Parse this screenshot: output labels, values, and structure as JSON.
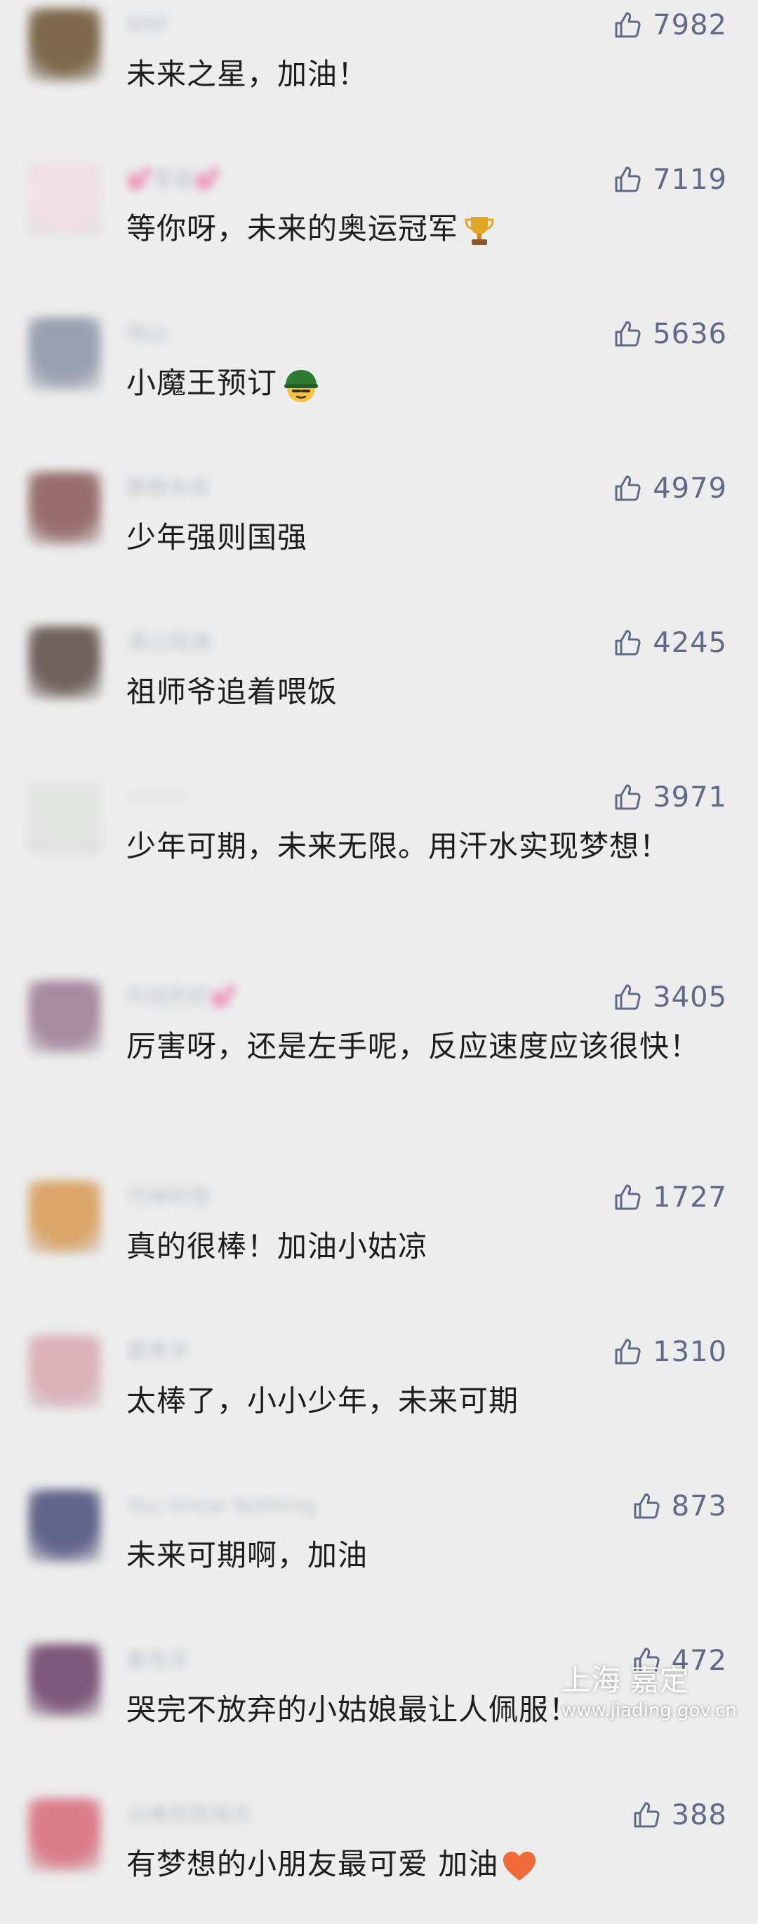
{
  "colors": {
    "background": "#ededed",
    "comment_text": "#1d1d1d",
    "like_count": "#5f6a86",
    "username_blurred": "#9aa2b5"
  },
  "comments": [
    {
      "username": "NNF",
      "text": "未来之星，加油！",
      "likes": "7982",
      "avatar_color": "#6b5230",
      "emoji": ""
    },
    {
      "username": "💕荟荟💕",
      "text": "等你呀，未来的奥运冠军",
      "likes": "7119",
      "avatar_color": "#f3dfe6",
      "emoji": "trophy-icon"
    },
    {
      "username": "晓山",
      "text": "小魔王预订",
      "likes": "5636",
      "avatar_color": "#8b94a6",
      "emoji": "helmet-face-icon"
    },
    {
      "username": "静静未来",
      "text": "少年强则国强",
      "likes": "4979",
      "avatar_color": "#8a5a58",
      "emoji": ""
    },
    {
      "username": "清山观澜",
      "text": "祖师爷追着喂饭",
      "likes": "4245",
      "avatar_color": "#5b4a44",
      "emoji": ""
    },
    {
      "username": "一一一",
      "text": "少年可期，未来无限。用汗水实现梦想！",
      "likes": "3971",
      "avatar_color": "#e2e4e2",
      "emoji": ""
    },
    {
      "username": "科技奶奶💕",
      "text": "厉害呀，还是左手呢，反应速度应该很快！",
      "likes": "3405",
      "avatar_color": "#9b7a92",
      "emoji": ""
    },
    {
      "username": "竹林听雨",
      "text": "真的很棒！加油小姑凉",
      "likes": "1727",
      "avatar_color": "#d79a52",
      "emoji": ""
    },
    {
      "username": "夏季半",
      "text": "太棒了，小小少年，未来可期",
      "likes": "1310",
      "avatar_color": "#d8a8b0",
      "emoji": ""
    },
    {
      "username": "You Know Nothing",
      "text": "未来可期啊，加油",
      "likes": "873",
      "avatar_color": "#4a4e7a",
      "emoji": ""
    },
    {
      "username": "紫色天",
      "text": "哭完不放弃的小姑娘最让人佩服！",
      "likes": "472",
      "avatar_color": "#6a3f66",
      "emoji": ""
    },
    {
      "username": "云峰观观海天",
      "text": "有梦想的小朋友最可爱 加油",
      "likes": "388",
      "avatar_color": "#d86a7a",
      "emoji": "heart-icon"
    }
  ],
  "watermark": {
    "title": "上海 嘉定",
    "url": "www.jiading.gov.cn"
  }
}
